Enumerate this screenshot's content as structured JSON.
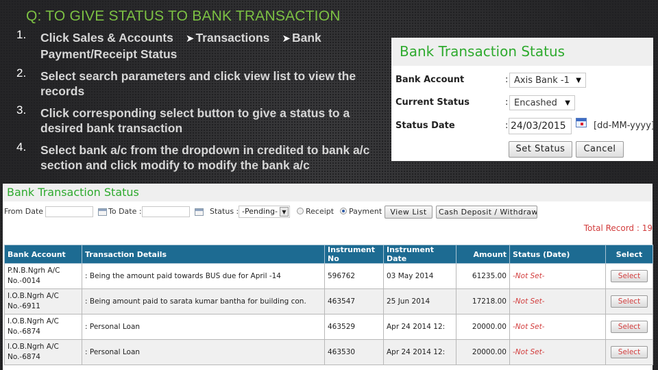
{
  "slide": {
    "title": "Q: TO GIVE STATUS TO BANK TRANSACTION",
    "steps": [
      {
        "num": "1.",
        "parts": [
          "Click  Sales & Accounts",
          "Transactions",
          "Bank Payment/Receipt Status"
        ],
        "arrow": "➤"
      },
      {
        "num": "2.",
        "text": "Select search parameters and click view list to view the records"
      },
      {
        "num": "3.",
        "text": "Click  corresponding select button to give a status to a desired bank transaction"
      },
      {
        "num": "4.",
        "text": "Select bank a/c from the dropdown in credited to bank a/c section and click modify to modify the bank a/c"
      }
    ]
  },
  "status_form": {
    "title": "Bank Transaction Status",
    "bank_account": {
      "label": "Bank Account",
      "colon": ":",
      "value": "Axis Bank -1"
    },
    "current_status": {
      "label": "Current Status",
      "colon": ":",
      "value": "Encashed"
    },
    "status_date": {
      "label": "Status Date",
      "colon": ":",
      "value": "24/03/2015",
      "format_hint": "[dd-MM-yyyy]"
    },
    "caret": "▼",
    "buttons": {
      "set_status": "Set Status",
      "cancel": "Cancel"
    }
  },
  "list": {
    "title": "Bank Transaction Status",
    "filters": {
      "from_date_label": "From Date :",
      "from_date_value": "",
      "to_date_label": "To Date :",
      "to_date_value": "",
      "status_label": "Status :",
      "status_value": "-Pending-",
      "dropdown_glyph": "▼",
      "radio_receipt": "Receipt",
      "radio_payment": "Payment",
      "selected_radio": "Payment",
      "view_list": "View List",
      "cash_deposit": "Cash Deposit / Withdrawl"
    },
    "total_record": "Total Record : 19",
    "columns": [
      "Bank Account",
      "Transaction Details",
      "Instrument No",
      "Instrument Date",
      "Amount",
      "Status (Date)",
      "Select"
    ],
    "rows": [
      {
        "account_line1": "P.N.B.Ngrh A/C",
        "account_line2": "No.-0014",
        "details": ": Being the amount paid towards BUS due for April -14",
        "instrument_no": "596762",
        "instrument_date": "03 May 2014",
        "amount": "61235.00",
        "status": "-Not Set-",
        "select": "Select"
      },
      {
        "account_line1": "I.O.B.Ngrh A/C",
        "account_line2": "No.-6911",
        "details": ": Being amount paid to sarata kumar bantha for building con.",
        "instrument_no": "463547",
        "instrument_date": "25 Jun 2014",
        "amount": "17218.00",
        "status": "-Not Set-",
        "select": "Select"
      },
      {
        "account_line1": "I.O.B.Ngrh A/C",
        "account_line2": "No.-6874",
        "details": ": Personal Loan",
        "instrument_no": "463529",
        "instrument_date": "Apr 24 2014 12:",
        "amount": "20000.00",
        "status": "-Not Set-",
        "select": "Select"
      },
      {
        "account_line1": "I.O.B.Ngrh A/C",
        "account_line2": "No.-6874",
        "details": ": Personal Loan",
        "instrument_no": "463530",
        "instrument_date": "Apr 24 2014 12:",
        "amount": "20000.00",
        "status": "-Not Set-",
        "select": "Select"
      }
    ]
  },
  "colors": {
    "title_green": "#7cc143",
    "panel_title_green": "#2eaa2e",
    "header_blue": "#1d6b92",
    "alert_red": "#d23c3c"
  }
}
